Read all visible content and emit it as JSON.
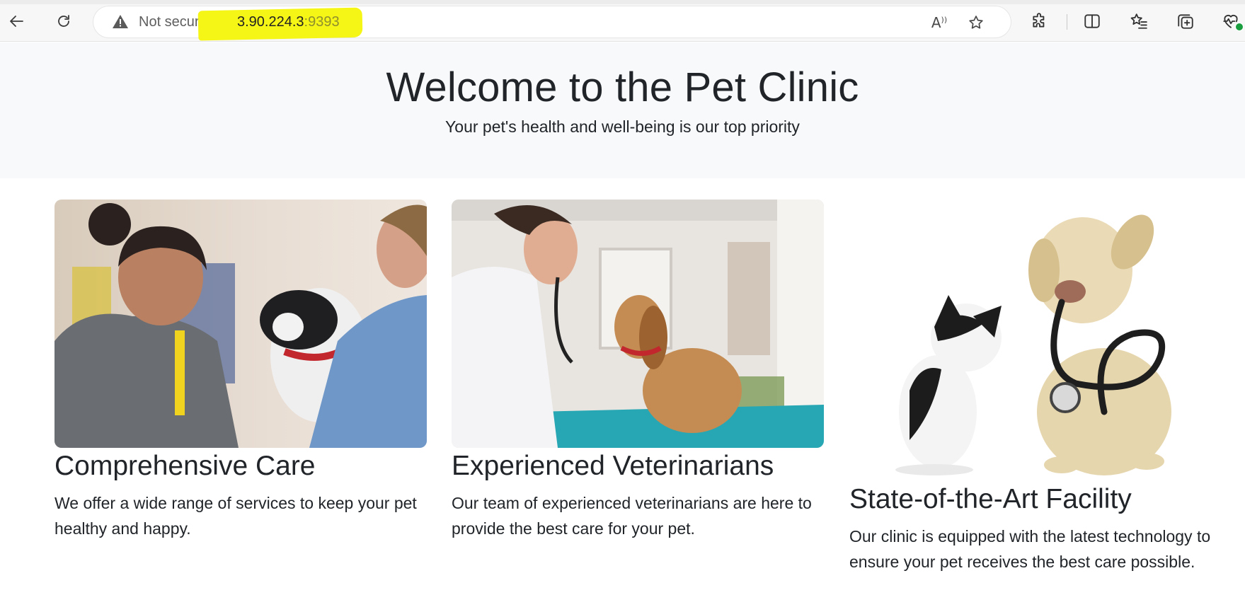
{
  "browser": {
    "security_label": "Not secure",
    "url_host": "3.90.224.3",
    "url_port": ":9393",
    "icons": [
      "back-arrow-icon",
      "reload-icon",
      "warning-icon",
      "read-aloud-icon",
      "favorite-star-icon",
      "extensions-icon",
      "split-screen-icon",
      "favorites-icon",
      "collections-icon",
      "browser-essentials-icon"
    ],
    "highlight_color": "#f5f516"
  },
  "hero": {
    "title": "Welcome to the Pet Clinic",
    "subtitle": "Your pet's health and well-being is our top priority"
  },
  "cards": [
    {
      "title": "Comprehensive Care",
      "text": "We offer a wide range of services to keep your pet healthy and happy."
    },
    {
      "title": "Experienced Veterinarians",
      "text": "Our team of experienced veterinarians are here to provide the best care for your pet."
    },
    {
      "title": "State-of-the-Art Facility",
      "text": "Our clinic is equipped with the latest technology to ensure your pet receives the best care possible."
    }
  ]
}
